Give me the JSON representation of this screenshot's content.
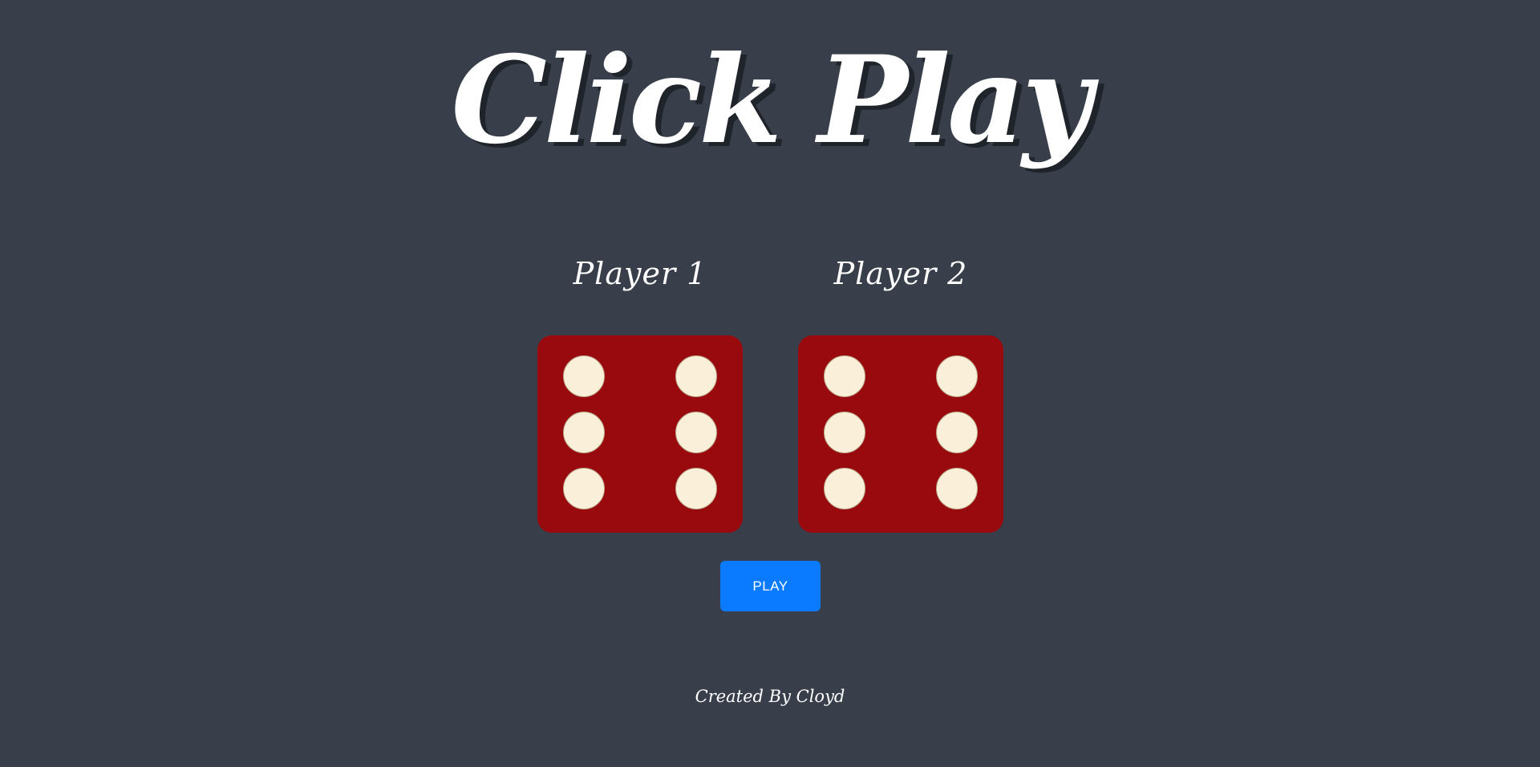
{
  "title": "Click Play",
  "players": [
    {
      "label": "Player 1",
      "die_value": 6
    },
    {
      "label": "Player 2",
      "die_value": 6
    }
  ],
  "play_button": {
    "label": "PLAY"
  },
  "footer": {
    "credit": "Created By Cloyd"
  },
  "colors": {
    "background": "#393f4a",
    "die_face": "#990a0e",
    "die_dot": "#faefd8",
    "button": "#0a7bff",
    "text": "#ffffff"
  }
}
